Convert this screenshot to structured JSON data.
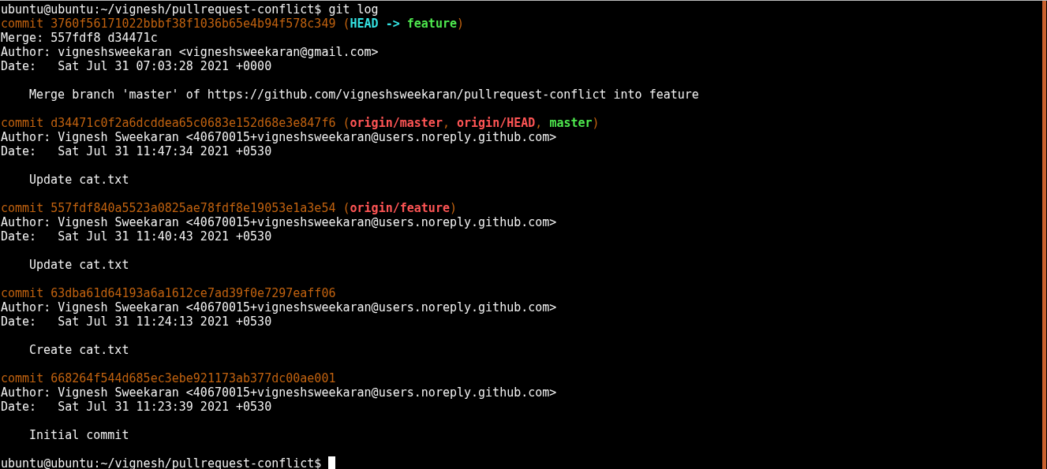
{
  "prompt": {
    "text": "ubuntu@ubuntu:~/vignesh/pullrequest-conflict$",
    "command": " git log"
  },
  "commits": [
    {
      "segments": [
        {
          "text": "commit 3760f56171022bbbf38f1036b65e4b94f578c349",
          "kind": "hash"
        },
        {
          "text": " (",
          "kind": "punct"
        },
        {
          "text": "HEAD -> ",
          "kind": "head"
        },
        {
          "text": "feature",
          "kind": "local"
        },
        {
          "text": ")",
          "kind": "punct"
        }
      ],
      "merge": "Merge: 557fdf8 d34471c",
      "author": "Author: vigneshsweekaran <vigneshsweekaran@gmail.com>",
      "date": "Date:   Sat Jul 31 07:03:28 2021 +0000",
      "message": "Merge branch 'master' of https://github.com/vigneshsweekaran/pullrequest-conflict into feature"
    },
    {
      "segments": [
        {
          "text": "commit d34471c0f2a6dcddea65c0683e152d68e3e847f6",
          "kind": "hash"
        },
        {
          "text": " (",
          "kind": "punct"
        },
        {
          "text": "origin/master",
          "kind": "remote"
        },
        {
          "text": ", ",
          "kind": "punct"
        },
        {
          "text": "origin/HEAD",
          "kind": "remote"
        },
        {
          "text": ", ",
          "kind": "punct"
        },
        {
          "text": "master",
          "kind": "local"
        },
        {
          "text": ")",
          "kind": "punct"
        }
      ],
      "author": "Author: Vignesh Sweekaran <40670015+vigneshsweekaran@users.noreply.github.com>",
      "date": "Date:   Sat Jul 31 11:47:34 2021 +0530",
      "message": "Update cat.txt"
    },
    {
      "segments": [
        {
          "text": "commit 557fdf840a5523a0825ae78fdf8e19053e1a3e54",
          "kind": "hash"
        },
        {
          "text": " (",
          "kind": "punct"
        },
        {
          "text": "origin/feature",
          "kind": "remote"
        },
        {
          "text": ")",
          "kind": "punct"
        }
      ],
      "author": "Author: Vignesh Sweekaran <40670015+vigneshsweekaran@users.noreply.github.com>",
      "date": "Date:   Sat Jul 31 11:40:43 2021 +0530",
      "message": "Update cat.txt"
    },
    {
      "segments": [
        {
          "text": "commit 63dba61d64193a6a1612ce7ad39f0e7297eaff06",
          "kind": "hash"
        }
      ],
      "author": "Author: Vignesh Sweekaran <40670015+vigneshsweekaran@users.noreply.github.com>",
      "date": "Date:   Sat Jul 31 11:24:13 2021 +0530",
      "message": "Create cat.txt"
    },
    {
      "segments": [
        {
          "text": "commit 668264f544d685ec3ebe921173ab377dc00ae001",
          "kind": "hash"
        }
      ],
      "author": "Author: Vignesh Sweekaran <40670015+vigneshsweekaran@users.noreply.github.com>",
      "date": "Date:   Sat Jul 31 11:23:39 2021 +0530",
      "message": "Initial commit"
    }
  ],
  "final_prompt": {
    "text": "ubuntu@ubuntu:~/vignesh/pullrequest-conflict$",
    "cursor": true
  }
}
